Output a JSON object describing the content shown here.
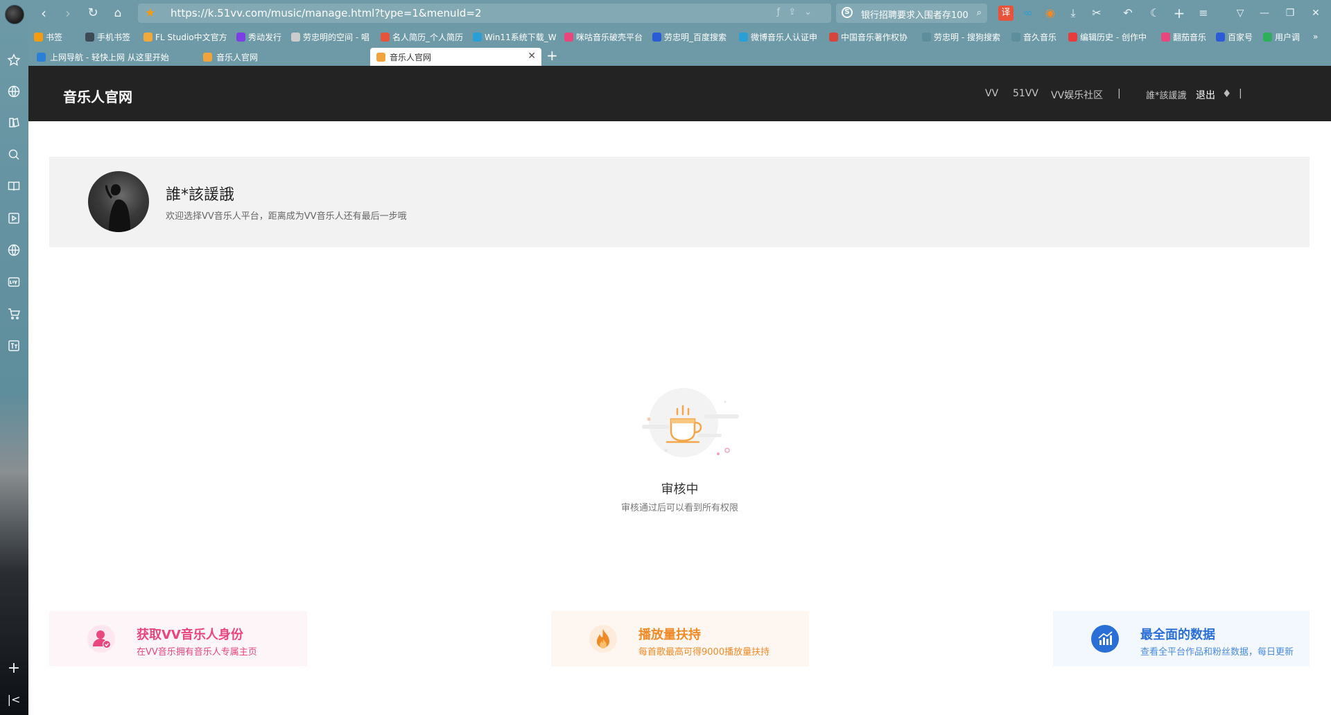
{
  "browser": {
    "url": "https://k.51vv.com/music/manage.html?type=1&menuId=2",
    "search_text": "银行招聘要求入围者存100",
    "bookmarks": [
      {
        "label": "书签",
        "color": "#f39c12"
      },
      {
        "label": "手机书签",
        "color": "#3b4a55"
      },
      {
        "label": "FL Studio中文官方",
        "color": "#f2a93b"
      },
      {
        "label": "秀动发行",
        "color": "#7b3fe4"
      },
      {
        "label": "劳忠明的空间 - 唱",
        "color": "#cccccc"
      },
      {
        "label": "名人简历_个人简历",
        "color": "#e8533b"
      },
      {
        "label": "Win11系统下载_W",
        "color": "#2a9fd6"
      },
      {
        "label": "咪咕音乐破壳平台",
        "color": "#e8467c"
      },
      {
        "label": "劳忠明_百度搜索",
        "color": "#2b5bd6"
      },
      {
        "label": "微博音乐人认证申",
        "color": "#2a9fd6"
      },
      {
        "label": "中国音乐著作权协",
        "color": "#d6453b"
      },
      {
        "label": "劳忠明 - 搜狗搜索",
        "color": "#5e8d9c"
      },
      {
        "label": "音久音乐",
        "color": "#5e8d9c"
      },
      {
        "label": "编辑历史 - 创作中",
        "color": "#e83b3b"
      },
      {
        "label": "翻茄音乐",
        "color": "#e8467c"
      },
      {
        "label": "百家号",
        "color": "#2b5bd6"
      },
      {
        "label": "用户调",
        "color": "#2fae5b"
      }
    ],
    "tabs": [
      {
        "label": "上网导航 - 轻快上网 从这里开始",
        "color": "#2a7fd6",
        "active": false
      },
      {
        "label": "音乐人官网",
        "color": "#f0a43b",
        "active": false
      },
      {
        "label": "音乐人官网",
        "color": "#f0a43b",
        "active": true
      }
    ]
  },
  "site": {
    "title": "音乐人官网",
    "nav": [
      "VV",
      "51VV",
      "VV娱乐社区"
    ],
    "separator": "|",
    "username": "誰*該諼誐",
    "logout": "退出"
  },
  "profile": {
    "name": "誰*該諼誐",
    "description": "欢迎选择VV音乐人平台，距离成为VV音乐人还有最后一步哦"
  },
  "status": {
    "title": "审核中",
    "subtitle": "审核通过后可以看到所有权限"
  },
  "features": [
    {
      "title": "获取VV音乐人身份",
      "subtitle": "在VV音乐拥有音乐人专属主页",
      "icon": "user-badge-icon",
      "color": "#e8467c"
    },
    {
      "title": "播放量扶持",
      "subtitle": "每首歌最高可得9000播放量扶持",
      "icon": "fire-icon",
      "color": "#f08a26"
    },
    {
      "title": "最全面的数据",
      "subtitle": "查看全平台作品和粉丝数据，每日更新",
      "icon": "chart-icon",
      "color": "#2a6fd6"
    }
  ]
}
